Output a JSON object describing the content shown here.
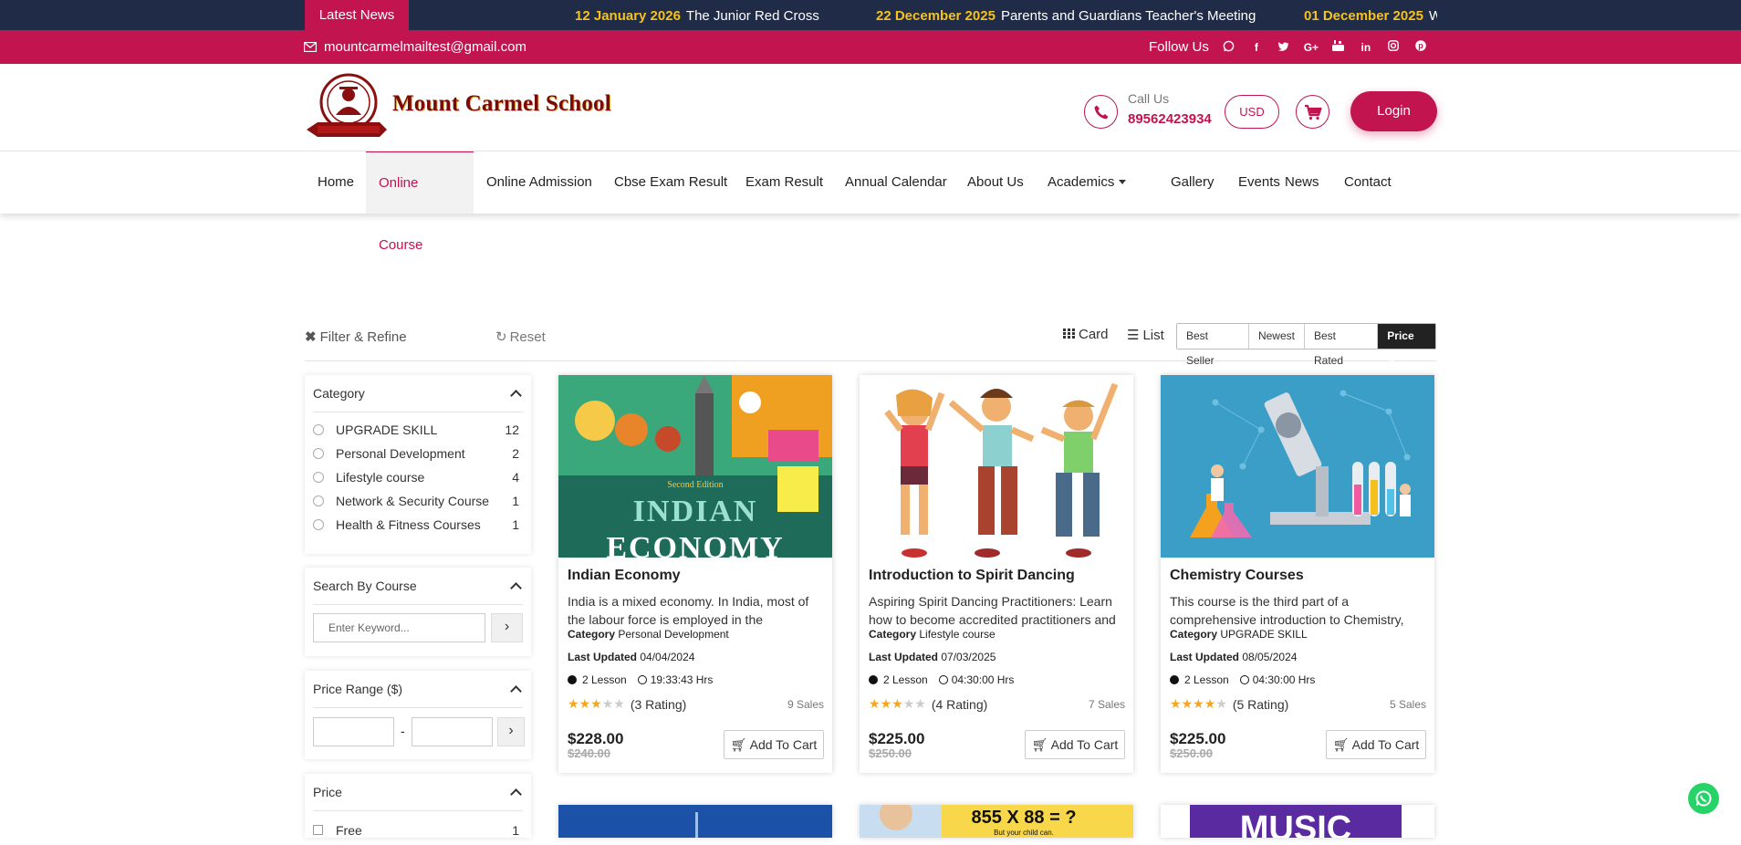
{
  "ticker": {
    "label": "Latest News",
    "items": [
      {
        "date": "12 January 2026",
        "text": "The Junior Red Cross"
      },
      {
        "date": "22 December 2025",
        "text": "Parents and Guardians Teacher's Meeting"
      },
      {
        "date": "01 December 2025",
        "text": "Wir"
      }
    ]
  },
  "contact_bar": {
    "email": "mountcarmelmailtest@gmail.com",
    "follow_label": "Follow Us",
    "socials": [
      "whatsapp-icon",
      "facebook-icon",
      "twitter-icon",
      "google-plus-icon",
      "youtube-icon",
      "linkedin-icon",
      "instagram-icon",
      "pinterest-icon"
    ]
  },
  "header": {
    "school_name": "Mount Carmel School",
    "call_label": "Call Us",
    "call_number": "89562423934",
    "currency": "USD",
    "login_label": "Login"
  },
  "nav": {
    "items": [
      "Home",
      "Online Course",
      "Online Admission",
      "Cbse Exam Result",
      "Exam Result",
      "Annual Calendar",
      "About Us",
      "Academics",
      "Gallery",
      "Events",
      "News",
      "Contact"
    ],
    "active": "Online Course"
  },
  "toolbar": {
    "filter_label": "Filter & Refine",
    "reset_label": "Reset",
    "card_label": "Card",
    "list_label": "List",
    "sort_options": [
      "Best Seller",
      "Newest",
      "Best Rated",
      "Price"
    ],
    "sort_active": "Price"
  },
  "filters": {
    "category_title": "Category",
    "categories": [
      {
        "name": "UPGRADE SKILL",
        "count": "12"
      },
      {
        "name": "Personal Development",
        "count": "2"
      },
      {
        "name": "Lifestyle course",
        "count": "4"
      },
      {
        "name": "Network & Security Course",
        "count": "1"
      },
      {
        "name": "Health & Fitness Courses",
        "count": "1"
      }
    ],
    "search_title": "Search By Course",
    "search_placeholder": "Enter Keyword...",
    "price_range_title": "Price Range ($)",
    "price_range_separator": "-",
    "price_title": "Price",
    "price_options": [
      {
        "name": "Free",
        "count": "1"
      }
    ]
  },
  "courses": [
    {
      "title": "Indian Economy",
      "description": "India is a mixed economy. In India, most of the labour force is employed in the",
      "category_label": "Category",
      "category": "Personal Development",
      "updated_label": "Last Updated",
      "updated": "04/04/2024",
      "lessons": "2 Lesson",
      "duration": "19:33:43 Hrs",
      "rating_stars": 3,
      "rating_text": "(3 Rating)",
      "sales": "9 Sales",
      "price": "$228.00",
      "old_price": "$240.00",
      "cart_label": "Add To Cart",
      "image_text": {
        "edition": "Second Edition",
        "line1": "INDIAN",
        "line2": "ECONOMY"
      }
    },
    {
      "title": "Introduction to Spirit Dancing",
      "description": "Aspiring Spirit Dancing Practitioners: Learn how to become accredited practitioners and",
      "category_label": "Category",
      "category": "Lifestyle course",
      "updated_label": "Last Updated",
      "updated": "07/03/2025",
      "lessons": "2 Lesson",
      "duration": "04:30:00 Hrs",
      "rating_stars": 3,
      "rating_text": "(4 Rating)",
      "sales": "7 Sales",
      "price": "$225.00",
      "old_price": "$250.00",
      "cart_label": "Add To Cart"
    },
    {
      "title": "Chemistry Courses",
      "description": "This course is the third part of a comprehensive introduction to Chemistry,",
      "category_label": "Category",
      "category": "UPGRADE SKILL",
      "updated_label": "Last Updated",
      "updated": "08/05/2024",
      "lessons": "2 Lesson",
      "duration": "04:30:00 Hrs",
      "rating_stars": 4,
      "rating_text": "(5 Rating)",
      "sales": "5 Sales",
      "price": "$225.00",
      "old_price": "$250.00",
      "cart_label": "Add To Cart"
    }
  ],
  "next_row": [
    {
      "image_text": ""
    },
    {
      "image_text": "855 X 88 = ?",
      "sub_text": "But your child can."
    },
    {
      "image_text": "MUSIC"
    }
  ],
  "colors": {
    "brand": "#c2144e",
    "navy": "#1f2b47",
    "star": "#f5a623",
    "news_date": "#f6c21b"
  }
}
